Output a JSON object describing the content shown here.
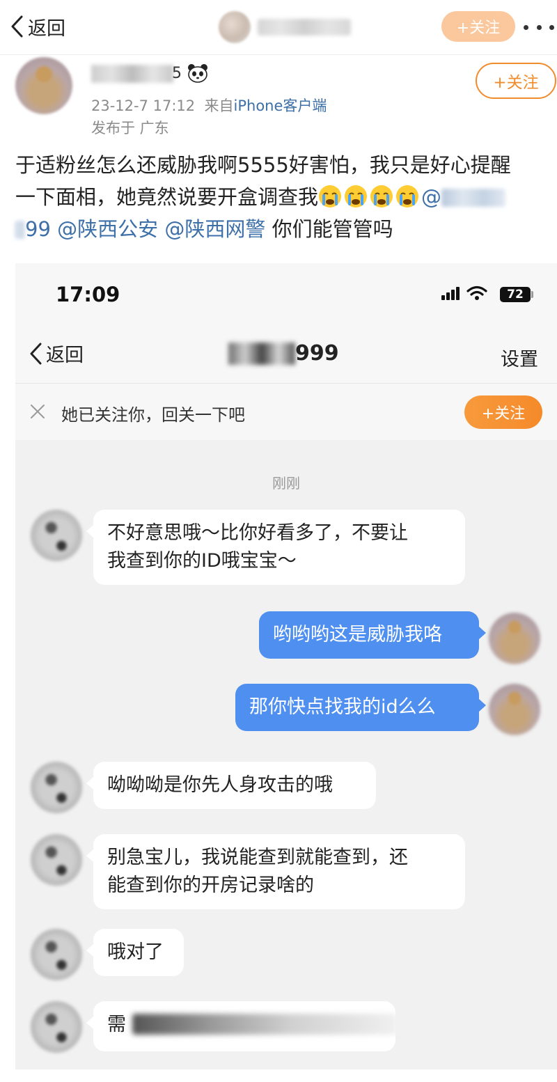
{
  "topbar": {
    "back_label": "返回",
    "follow_label": "+关注"
  },
  "post": {
    "author_name_suffix": "5",
    "time": "23-12-7 17:12",
    "source_prefix": "来自",
    "client": "iPhone客户端",
    "location": "发布于 广东",
    "follow_label": "+关注",
    "text_line1": "于适粉丝怎么还威胁我啊5555好害怕，我只是好心提醒",
    "text_line2": "一下面相，她竟然说要开盒调查我",
    "mention_partial_1": "@",
    "mention_partial_2": "99",
    "mention_2": "@陕西公安",
    "mention_3": "@陕西网警",
    "text_tail": "你们能管管吗"
  },
  "screenshot": {
    "status_time": "17:09",
    "battery": "72",
    "nav_back": "返回",
    "chat_title": "999",
    "settings": "设置",
    "follow_tip": "她已关注你，回关一下吧",
    "follow_btn": "+关注",
    "timestamp": "刚刚",
    "messages": [
      {
        "from": "them",
        "text_l1": "不好意思哦～比你好看多了，不要让",
        "text_l2": "我查到你的ID哦宝宝～"
      },
      {
        "from": "me",
        "text": "哟哟哟这是威胁我咯"
      },
      {
        "from": "me",
        "text": "那你快点找我的id么么"
      },
      {
        "from": "them",
        "text": "呦呦呦是你先人身攻击的哦"
      },
      {
        "from": "them",
        "text_l1": "别急宝儿，我说能查到就能查到，还",
        "text_l2": "能查到你的开房记录啥的"
      },
      {
        "from": "them",
        "text": "哦对了"
      },
      {
        "from": "them",
        "text": "需"
      }
    ]
  },
  "icons": {
    "back": "chevron-left-icon",
    "more": "more-dots-icon",
    "panda": "panda-icon",
    "emoji": "crying-face-icon",
    "close": "close-icon",
    "signal": "signal-icon",
    "wifi": "wifi-icon",
    "battery": "battery-icon"
  },
  "colors": {
    "accent_orange": "#f28b2b",
    "mention_blue": "#3d6fa8",
    "my_bubble": "#4f8ff0"
  }
}
